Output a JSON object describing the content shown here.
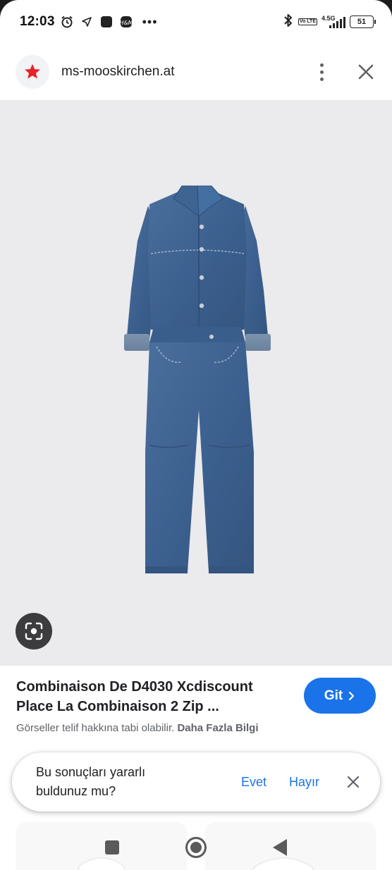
{
  "status_bar": {
    "time": "12:03",
    "network_label": "4.5G",
    "volte_label": "Vo LTE",
    "battery": "51"
  },
  "site": {
    "name": "ms-mooskirchen.at",
    "favicon_icon": "red-star-icon",
    "favicon_color": "#e8212a"
  },
  "result": {
    "title_line1": "Combinaison De D4030 Xcdiscount",
    "title_line2": "Place La Combinaison 2 Zip ...",
    "copyright_text": "Görseller telif hakkına tabi olabilir.",
    "more_info_label": "Daha Fazla Bilgi",
    "visit_label": "Git",
    "accent": "#1a73e8"
  },
  "feedback": {
    "question": "Bu sonuçları yararlı buldunuz mu?",
    "yes_label": "Evet",
    "no_label": "Hayır"
  }
}
